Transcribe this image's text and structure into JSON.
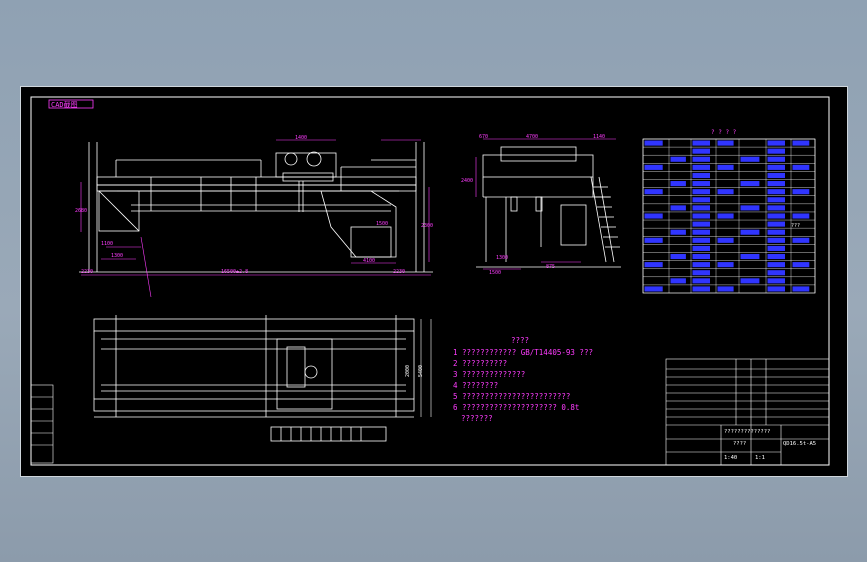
{
  "header_label": "CAD截图",
  "notes": {
    "title": "????",
    "lines": [
      "1 ???????????? GB/T14405-93 ???",
      "2 ??????????",
      "3 ??????????????",
      "4 ????????",
      "5 ????????????????????????",
      "6 ????????????????????? 0.8t",
      "???????"
    ]
  },
  "dimensions": {
    "front": [
      "1400",
      "16500±2.8",
      "2230",
      "2230",
      "1500",
      "4100",
      "2300",
      "1300",
      "1100",
      "2680"
    ],
    "side": [
      "4700",
      "1140",
      "670",
      "1500",
      "1300",
      "875",
      "2400"
    ],
    "plan": [
      "5400",
      "2000"
    ]
  },
  "table": {
    "title": "? ? ? ?",
    "note": "???"
  },
  "title_block": {
    "model": "QD16.5t-A5",
    "spec": "??????????????",
    "part_no": "????",
    "scale": "1:40",
    "sheet": "1:1"
  },
  "colors": {
    "background": "#000000",
    "lines": "#ffffff",
    "annotation": "#ff3cff",
    "table": "#4a4cff",
    "dim": "#ff3cff"
  }
}
